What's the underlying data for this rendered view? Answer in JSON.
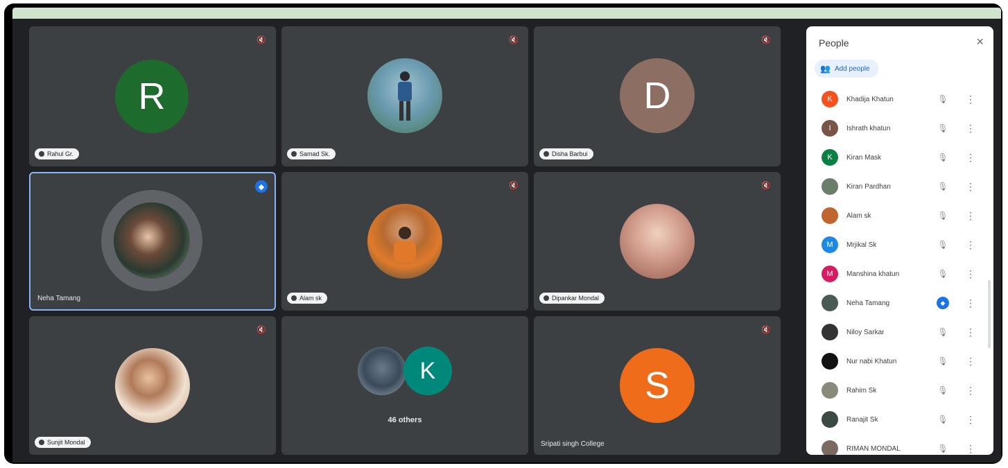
{
  "tiles": [
    {
      "id": "t1",
      "avatar_letter": "R",
      "avatar_color": "#1e6b2e",
      "name": "Rahul Gr.",
      "name_style": "chip",
      "mic": "muted"
    },
    {
      "id": "t2",
      "avatar_letter": "",
      "avatar_photo": "#6b9bb0",
      "name": "Samad Sk.",
      "name_style": "chip",
      "mic": "muted"
    },
    {
      "id": "t3",
      "avatar_letter": "D",
      "avatar_color": "#8d6e63",
      "name": "Disha Barbui",
      "name_style": "chip",
      "mic": "muted"
    },
    {
      "id": "t4",
      "avatar_letter": "",
      "avatar_photo": "#4a5a55",
      "name": "Neha Tamang",
      "name_style": "plain",
      "mic": "speaking",
      "active": true
    },
    {
      "id": "t5",
      "avatar_letter": "",
      "avatar_photo": "#c0652e",
      "name": "Alam sk",
      "name_style": "chip",
      "mic": "muted"
    },
    {
      "id": "t6",
      "avatar_letter": "",
      "avatar_photo": "#c99a8a",
      "name": "Dipankar Mondal",
      "name_style": "chip",
      "mic": "muted"
    },
    {
      "id": "t7",
      "avatar_letter": "",
      "avatar_photo": "#b07a5a",
      "name": "Sunjit Mondal",
      "name_style": "chip",
      "mic": "muted"
    },
    {
      "id": "t8",
      "avatar_letter": "K",
      "avatar_color": "#00897b",
      "others_label": "46 others",
      "mic": "none"
    },
    {
      "id": "t9",
      "avatar_letter": "S",
      "avatar_color": "#ef6c1a",
      "name": "Sripati singh College",
      "name_style": "plain",
      "mic": "muted"
    }
  ],
  "panel": {
    "title": "People",
    "close_icon": "×",
    "add_people_label": "Add people",
    "participants": [
      {
        "name": "Khadija Khatun",
        "color": "#f4511e",
        "letter": "K",
        "mic": "muted"
      },
      {
        "name": "Ishrath khatun",
        "color": "#795548",
        "letter": "I",
        "mic": "muted"
      },
      {
        "name": "Kiran Mask",
        "color": "#0b8043",
        "letter": "K",
        "mic": "muted"
      },
      {
        "name": "Kiran Pardhan",
        "color": "#6b7d6b",
        "letter": "",
        "mic": "muted"
      },
      {
        "name": "Alam sk",
        "color": "#c0652e",
        "letter": "",
        "mic": "muted"
      },
      {
        "name": "Mrjikal Sk",
        "color": "#1e88e5",
        "letter": "M",
        "mic": "muted"
      },
      {
        "name": "Manshina khatun",
        "color": "#d81b60",
        "letter": "M",
        "mic": "muted"
      },
      {
        "name": "Neha Tamang",
        "color": "#4a5a55",
        "letter": "",
        "mic": "speaking"
      },
      {
        "name": "Niloy Sarkar",
        "color": "#333333",
        "letter": "",
        "mic": "muted"
      },
      {
        "name": "Nur nabi Khatun",
        "color": "#111111",
        "letter": "",
        "mic": "muted"
      },
      {
        "name": "Rahim Sk",
        "color": "#8a8a7a",
        "letter": "",
        "mic": "muted"
      },
      {
        "name": "Ranajit Sk",
        "color": "#3d4a44",
        "letter": "",
        "mic": "muted"
      },
      {
        "name": "RIMAN MONDAL",
        "color": "#7a6a60",
        "letter": "",
        "mic": "muted"
      }
    ]
  }
}
